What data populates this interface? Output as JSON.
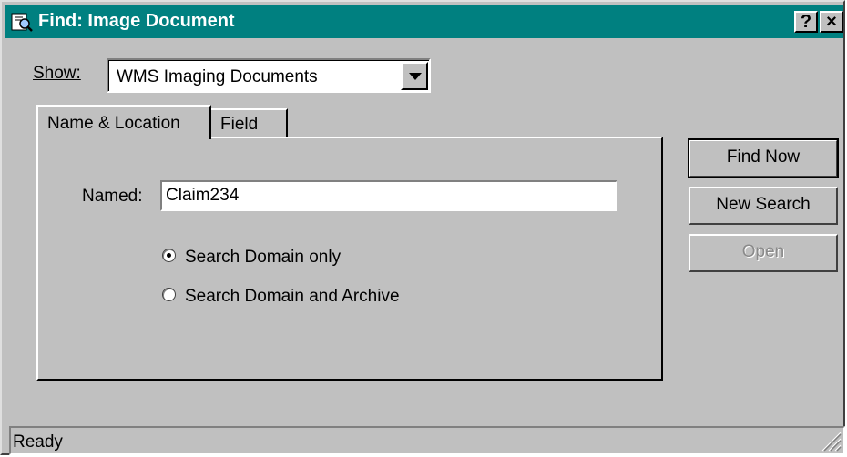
{
  "window": {
    "title": "Find: Image Document",
    "help_glyph": "?",
    "close_glyph": "×"
  },
  "show": {
    "label": "Show:",
    "value": "WMS Imaging Documents"
  },
  "tabs": [
    {
      "label": "Name & Location",
      "active": true
    },
    {
      "label": "Field",
      "active": false
    }
  ],
  "named": {
    "label": "Named:",
    "value": "Claim234"
  },
  "radios": [
    {
      "label": "Search Domain only",
      "checked": true
    },
    {
      "label": "Search Domain and Archive",
      "checked": false
    }
  ],
  "buttons": {
    "find_now": "Find Now",
    "new_search": "New Search",
    "open": "Open"
  },
  "status": {
    "text": "Ready"
  },
  "colors": {
    "titlebar": "#008080",
    "face": "#c0c0c0"
  },
  "icons": [
    "app-icon",
    "help-icon",
    "close-icon",
    "dropdown-arrow-icon",
    "size-grip-icon"
  ]
}
